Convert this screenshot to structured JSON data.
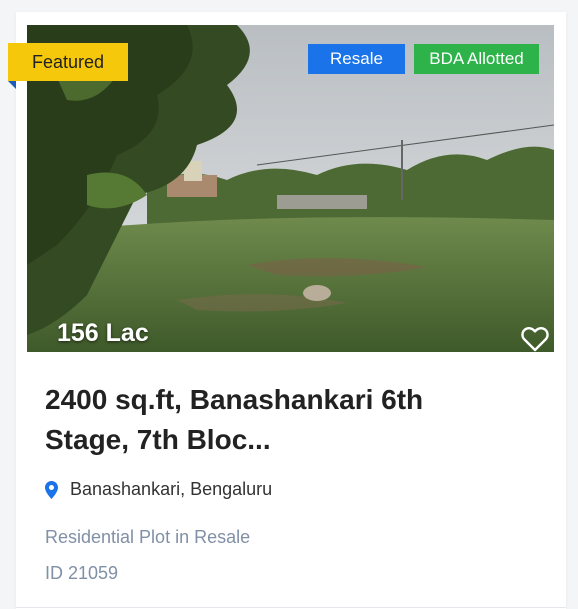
{
  "listing": {
    "featured_label": "Featured",
    "badges": [
      "Resale",
      "BDA Allotted"
    ],
    "price": "156 Lac",
    "title": "2400 sq.ft, Banashankari 6th Stage, 7th Bloc...",
    "location": "Banashankari, Bengaluru",
    "property_type": "Residential Plot in Resale",
    "property_id": "ID 21059"
  },
  "icons": {
    "favorite": "heart-outline-icon",
    "location": "map-pin-icon"
  },
  "colors": {
    "featured_bg": "#f5c80c",
    "resale_bg": "#1a73e8",
    "bda_bg": "#2db34a",
    "pin": "#1a73e8",
    "meta_text": "#8090a6"
  }
}
